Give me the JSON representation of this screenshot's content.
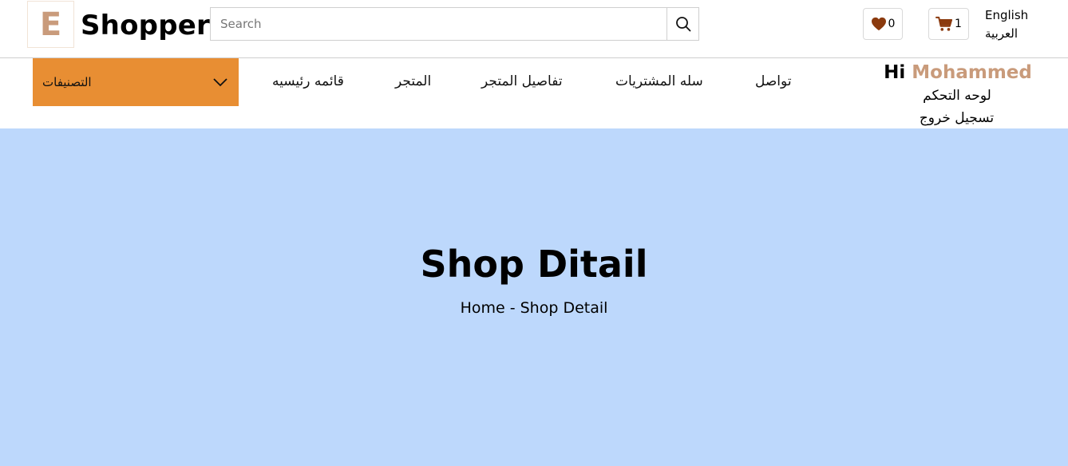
{
  "brand": {
    "letter": "E",
    "name": "Shopper"
  },
  "search": {
    "placeholder": "Search",
    "value": ""
  },
  "header": {
    "wishlist_count": "0",
    "cart_count": "1",
    "languages": [
      "English",
      "العربية"
    ]
  },
  "nav": {
    "categories_label": "التصنيفات",
    "links": [
      "قائمه رئيسيه",
      "المتجر",
      "تفاصيل المتجر",
      "سله المشتريات",
      "تواصل"
    ]
  },
  "user": {
    "greeting": "Hi",
    "name": "Mohammed",
    "dashboard": "لوحه التحكم",
    "logout": "تسجيل خروج"
  },
  "hero": {
    "title": "Shop Ditail",
    "breadcrumb": {
      "home": "Home",
      "separator": "-",
      "current": "Shop Detail"
    }
  },
  "colors": {
    "accent": "#e88e33",
    "brand": "#c99b7b",
    "hero_bg": "#bdd8fc",
    "icon_brown": "#8b3a0e"
  }
}
